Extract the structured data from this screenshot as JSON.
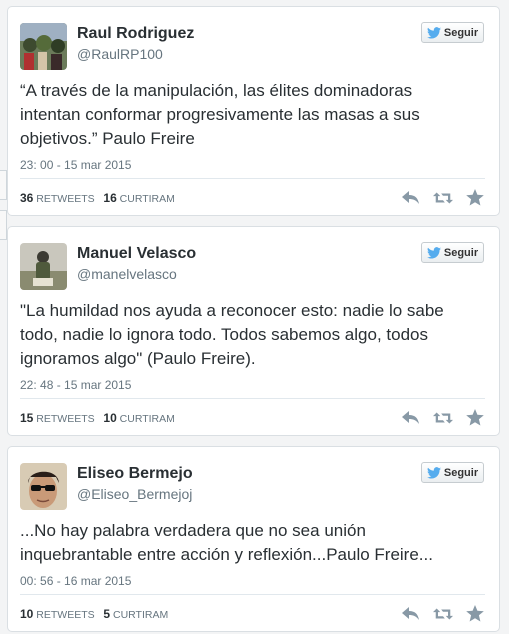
{
  "tweets": [
    {
      "name": "Raul Rodriguez",
      "handle": "@RaulRP100",
      "follow_label": "Seguir",
      "text": "“A través de la manipulación, las élites dominadoras intentan conformar progresivamente las masas a sus objetivos.” Paulo Freire",
      "time": "23: 00 - 15 mar 2015",
      "retweets": "36",
      "retweets_label": "RETWEETS",
      "likes": "16",
      "likes_label": "CURTIRAM"
    },
    {
      "name": "Manuel Velasco",
      "handle": "@manelvelasco",
      "follow_label": "Seguir",
      "text": "\"La humildad nos ayuda a reconocer esto: nadie lo sabe todo, nadie lo ignora todo. Todos sabemos algo, todos ignoramos algo\" (Paulo Freire).",
      "time": "22: 48 - 15 mar 2015",
      "retweets": "15",
      "retweets_label": "RETWEETS",
      "likes": "10",
      "likes_label": "CURTIRAM"
    },
    {
      "name": "Eliseo Bermejo",
      "handle": "@Eliseo_Bermejoj",
      "follow_label": "Seguir",
      "text": "...No hay palabra verdadera que no sea unión inquebrantable entre acción y reflexión...Paulo Freire...",
      "time": "00: 56 - 16 mar 2015",
      "retweets": "10",
      "retweets_label": "RETWEETS",
      "likes": "5",
      "likes_label": "CURTIRAM"
    }
  ],
  "colors": {
    "twitter_blue": "#55acee",
    "action_icon": "#8899a6",
    "secondary_text": "#66757f"
  },
  "icons": [
    "twitter-bird-icon",
    "reply-icon",
    "retweet-icon",
    "favorite-star-icon"
  ]
}
